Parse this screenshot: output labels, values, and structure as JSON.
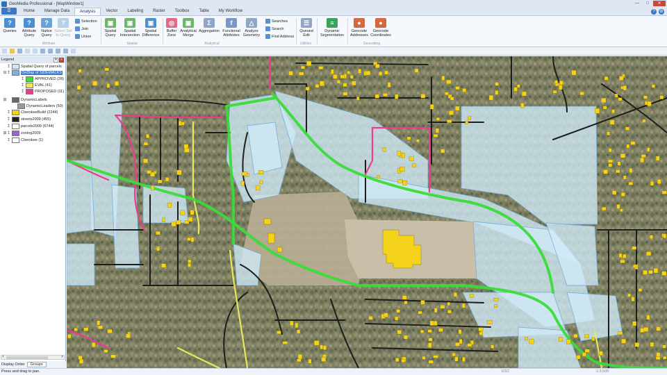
{
  "window": {
    "title": "GeoMedia Professional - [MapWindow1]"
  },
  "file_button": "☰",
  "tabs": [
    "Home",
    "Manage Data",
    "Analysis",
    "Vector",
    "Labeling",
    "Raster",
    "Toolbox",
    "Table",
    "My Workflow"
  ],
  "active_tab": "Analysis",
  "ribbon": {
    "queries": "Queries",
    "attribute_query": "Attribute Query",
    "native_query": "Native Query",
    "select_set_to_query": "Select Set to Query",
    "selection": "Selection",
    "join": "Join",
    "union": "Union",
    "spatial_query": "Spatial Query",
    "spatial_intersection": "Spatial Intersection",
    "spatial_difference": "Spatial Difference",
    "buffer_zone": "Buffer Zone",
    "analytical_merge": "Analytical Merge",
    "aggregation": "Aggregation",
    "functional_attributes": "Functional Attributes",
    "analyze_geometry": "Analyze Geometry",
    "searches": "Searches",
    "search": "Search",
    "find_address": "Find Address",
    "queued_edit": "Queued Edit",
    "dynamic_segmentation": "Dynamic Segmentation",
    "geocode_addresses": "Geocode Addresses",
    "geocode_coordinates": "Geocode Coordinates",
    "group_attribute": "Attribute",
    "group_spatial": "Spatial",
    "group_analytical": "Analytical",
    "group_utilities": "Utilities",
    "group_geocoding": "Geocoding"
  },
  "legend": {
    "title": "Legend",
    "items": [
      {
        "label": "Spatial Query of parcels",
        "color": "#cfe8f5",
        "selected": false
      },
      {
        "label": "OnDisp of SIDEWALKS",
        "color": "#7fb0e0",
        "selected": true
      },
      {
        "label": "APPROVED (28)",
        "color": "#3adb3a",
        "selected": false
      },
      {
        "label": "EVAL (41)",
        "color": "#e8e85a",
        "selected": false
      },
      {
        "label": "PROPOSED (11)",
        "color": "#ee3b8f",
        "selected": false
      },
      {
        "label": "DynamicLabels",
        "color": "#666666",
        "selected": false
      },
      {
        "label": "DynamicLeaders (50)",
        "color": "#999999",
        "selected": false
      },
      {
        "label": "CherokeeBuild (2244)",
        "color": "#f5d21a",
        "selected": false
      },
      {
        "label": "streets2009 (455)",
        "color": "#222222",
        "selected": false
      },
      {
        "label": "parcels2009 (6744)",
        "color": "#ffffff",
        "selected": false
      },
      {
        "label": "zoning2009",
        "color": "#9966cc",
        "selected": false
      },
      {
        "label": "Cherokee (1)",
        "color": "#ffffff",
        "selected": false
      }
    ],
    "scroll_left": "<",
    "scroll_right": ">",
    "footer_label": "Display Order",
    "footer_button": "Groups"
  },
  "status": {
    "message": "Press and drag to pan.",
    "key": "ESC",
    "scale": "1:3,500"
  },
  "colors": {
    "approved": "#3adb3a",
    "proposed": "#ee3b8f",
    "eval": "#e8e85a",
    "parcels_fill": "#cfeaf7",
    "building": "#f5d21a",
    "street": "#1d1d1d"
  }
}
